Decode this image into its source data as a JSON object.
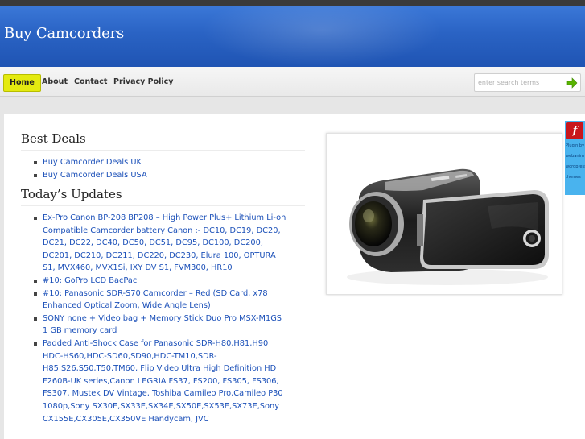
{
  "header": {
    "site_title": "Buy Camcorders"
  },
  "nav": {
    "items": [
      {
        "label": "Home",
        "active": true
      },
      {
        "label": "About",
        "active": false
      },
      {
        "label": "Contact",
        "active": false
      },
      {
        "label": "Privacy Policy",
        "active": false
      }
    ]
  },
  "search": {
    "placeholder": "enter search terms",
    "submit_icon": "arrow-right-icon",
    "accent": "#59b400"
  },
  "sidebar_widget": {
    "icon": "flash-plugin-icon",
    "lines": [
      "Plugin by",
      "webanim",
      "wordpress",
      "themes"
    ]
  },
  "best_deals": {
    "title": "Best Deals",
    "items": [
      "Buy Camcorder Deals UK",
      "Buy Camcorder Deals USA"
    ]
  },
  "updates": {
    "title": "Today’s Updates",
    "items": [
      "Ex-Pro Canon BP-208 BP208 – High Power Plus+ Lithium Li-on Compatible Camcorder battery Canon :- DC10, DC19, DC20, DC21, DC22, DC40, DC50, DC51, DC95, DC100, DC200, DC201, DC210, DC211, DC220, DC230, Elura 100, OPTURA S1, MVX460, MVX1Si, IXY DV S1, FVM300, HR10",
      "#10: GoPro LCD BacPac",
      "#10: Panasonic SDR-S70 Camcorder – Red (SD Card, x78 Enhanced Optical Zoom, Wide Angle Lens)",
      "SONY none + Video bag + Memory Stick Duo Pro MSX-M1GS 1 GB memory card",
      "Padded Anti-Shock Case for Panasonic SDR-H80,H81,H90 HDC-HS60,HDC-SD60,SD90,HDC-TM10,SDR-H85,S26,S50,T50,TM60, Flip Video Ultra High Definition HD F260B-UK series,Canon LEGRIA FS37, FS200, FS305, FS306, FS307, Mustek DV Vintage, Toshiba Camileo Pro,Camileo P30 1080p,Sony SX30E,SX33E,SX34E,SX50E,SX53E,SX73E,Sony CX155E,CX305E,CX350VE Handycam, JVC"
    ]
  },
  "colors": {
    "header_blue": "#2a63c4",
    "link_blue": "#1a4fb8",
    "home_highlight": "#e4ea10"
  }
}
